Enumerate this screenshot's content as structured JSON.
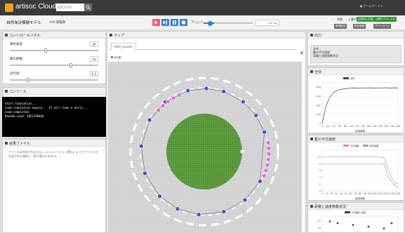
{
  "app": {
    "name": "artisoc Cloud",
    "search_placeholder": "検索文字列"
  },
  "user_menu": "● ゲームボード ▾",
  "header": {
    "model_title": "自然淘汰模擬モデル",
    "views": "440 閲覧数",
    "delay_label": "ディレイ",
    "delay_value": "100 ms",
    "status_label": "状態",
    "status_value": "上書中",
    "buttons_top": [
      "上書きした後",
      "公開モデルにする"
    ],
    "buttons_bottom": [
      "新規追加",
      "既存情報",
      "ダウンロード"
    ]
  },
  "control_panel": {
    "title": "コントロールパネル",
    "params": [
      {
        "label": "集中速度",
        "value": "40",
        "level": 0.4
      },
      {
        "label": "集の群数",
        "value": "10",
        "level": 0.7
      },
      {
        "label": "近行感",
        "value": "0.2",
        "level": 0.2
      }
    ]
  },
  "console": {
    "title": "コンソール",
    "lines": [
      "Start simulation...",
      "Load simulation engine... It will take a while...",
      "Load completed.",
      "Random seed: 1021296464"
    ]
  },
  "output_file": {
    "title": "結果ファイル",
    "text": "ファイルは作成されません。シミュレーション実行によってファイルが生成された場合に一覧が表示されます。"
  },
  "map": {
    "title": "マップ",
    "tab": "field_counter",
    "legend": "全行動"
  },
  "output": {
    "title": "出力",
    "items": [
      "全体",
      "集の平均速度",
      "距離と速度移動状況"
    ]
  },
  "charts": {
    "overall": "全体",
    "avg_speed": "集の平均速度",
    "distance_speed": "距離と速度移動状況"
  },
  "chart_data": [
    {
      "type": "line",
      "title": "全体",
      "series": [
        {
          "name": "全体",
          "color": "#444444",
          "values": [
            0,
            200,
            300,
            350,
            370,
            380,
            385,
            390,
            392,
            388,
            393,
            390,
            395,
            391,
            394,
            390,
            396,
            392,
            395,
            393
          ]
        }
      ],
      "x_ticks": [
        "0",
        "20",
        "40",
        "60",
        "80",
        "100",
        "120",
        "140",
        "160",
        "180",
        "200",
        "220",
        "240",
        "260"
      ],
      "y_ticks": [
        "0",
        "100",
        "200",
        "300",
        "400"
      ],
      "ylim": [
        0,
        450
      ],
      "xlim": [
        0,
        260
      ],
      "xlabel": "経過時間"
    },
    {
      "type": "line",
      "title": "集の平均速度",
      "categories_note": "x axis ticks",
      "series": [
        {
          "name": "平均速度",
          "color": "#e38aa4",
          "values": [
            10,
            10,
            10,
            10,
            10,
            10,
            10,
            10,
            10,
            10,
            10,
            10,
            10,
            9.8,
            6,
            3,
            2
          ]
        },
        {
          "name": "最低速度",
          "color": "#9b9bdc",
          "values": [
            8,
            8,
            8,
            8,
            8,
            8,
            8,
            8,
            8,
            8,
            8,
            8,
            8,
            7.8,
            4,
            2,
            1
          ]
        }
      ],
      "x_ticks": [
        "0",
        "10",
        "20",
        "30",
        "40",
        "50",
        "60",
        "70",
        "80",
        "90",
        "100",
        "110",
        "120",
        "130",
        "140",
        "150",
        "160"
      ],
      "y_ticks": [
        "0",
        "2",
        "4",
        "6",
        "8",
        "10"
      ],
      "ylim": [
        0,
        12
      ],
      "xlabel": "経過時間"
    },
    {
      "type": "scatter",
      "title": "距離と速度移動状況",
      "series": [
        {
          "name": "XX距離と速度",
          "color": "#444444",
          "points": [
            [
              1,
              15
            ],
            [
              2,
              14
            ],
            [
              4,
              13
            ],
            [
              6,
              12
            ],
            [
              8,
              11
            ],
            [
              9,
              14
            ]
          ]
        }
      ],
      "y_ticks": [
        "10",
        "15"
      ]
    }
  ],
  "colors": {
    "accent_blue": "#2d7fd8",
    "stop_red": "#f05a6e",
    "pink_agent": "#e070d0",
    "blue_agent": "#5050c8",
    "forest_green": "#5a9a3c"
  }
}
